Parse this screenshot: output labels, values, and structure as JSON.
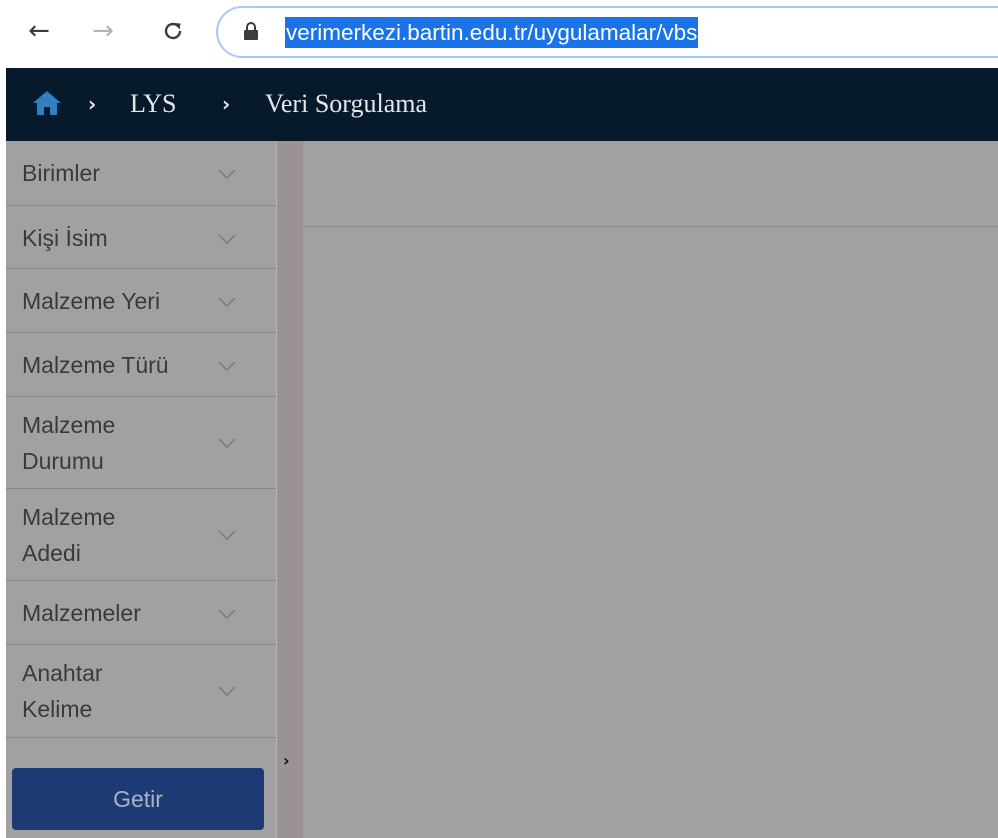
{
  "browser": {
    "url": "verimerkezi.bartin.edu.tr/uygulamalar/vbs",
    "back_icon": "←",
    "forward_icon": "→",
    "reload_icon": "C"
  },
  "header": {
    "breadcrumb": [
      {
        "label": "LYS"
      },
      {
        "label": "Veri Sorgulama"
      }
    ],
    "separator": "›",
    "home_icon_color": "#2f7fc1",
    "background": "#061a2c"
  },
  "sidebar": {
    "items": [
      {
        "label": "Birimler"
      },
      {
        "label": "Kişi İsim"
      },
      {
        "label": "Malzeme Yeri"
      },
      {
        "label": "Malzeme Türü"
      },
      {
        "label": "Malzeme\nDurumu"
      },
      {
        "label": "Malzeme\nAdedi"
      },
      {
        "label": "Malzemeler"
      },
      {
        "label": "Anahtar\nKelime"
      }
    ],
    "submit_label": "Getir",
    "expand_icon": "›"
  },
  "colors": {
    "overlay_gray": "#a1a1a1",
    "button_blue": "#1d3a74",
    "url_highlight": "#1a73e8"
  }
}
